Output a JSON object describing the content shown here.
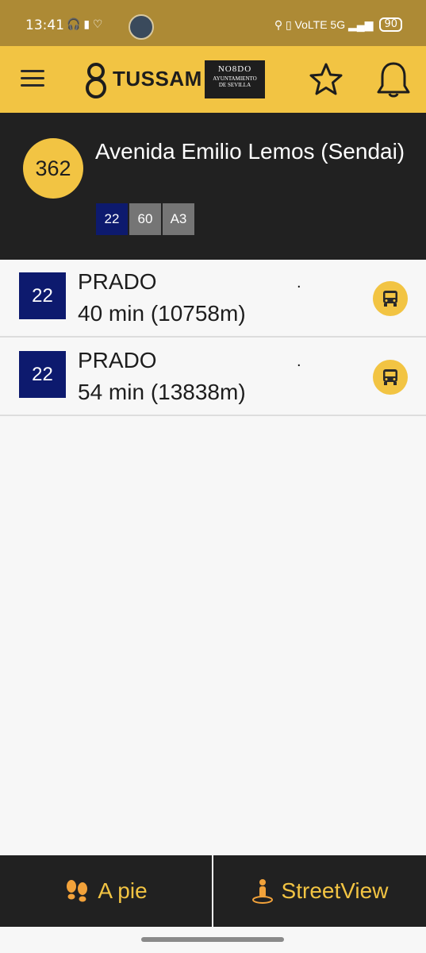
{
  "status_bar": {
    "time": "13:41",
    "left_icons": "🎧 ▮ ♡",
    "right_icons": "⚲ ▯ VoLTE 5G ▂▄▆",
    "battery": "90"
  },
  "app_bar": {
    "brand": "TUSSAM",
    "ayuntamiento_logo": {
      "line1": "NO8DO",
      "line2": "AYUNTAMIENTO",
      "line3": "DE SEVILLA"
    },
    "icons": [
      "menu-icon",
      "star-icon",
      "bell-icon"
    ]
  },
  "stop": {
    "number": "362",
    "name": "Avenida Emilio Lemos (Sendai)",
    "lines": [
      {
        "label": "22",
        "color": "#0d1a6e"
      },
      {
        "label": "60",
        "color": "#757575"
      },
      {
        "label": "A3",
        "color": "#757575"
      }
    ]
  },
  "arrivals": [
    {
      "line": "22",
      "destination": "PRADO",
      "eta": "40 min (10758m)",
      "marker": "."
    },
    {
      "line": "22",
      "destination": "PRADO",
      "eta": "54 min (13838m)",
      "marker": "."
    }
  ],
  "bottom_actions": {
    "walk_label": "A pie",
    "streetview_label": "StreetView"
  },
  "colors": {
    "accent": "#f2c443",
    "dark": "#212121",
    "line_blue": "#0d1a6e",
    "status_bar": "#ad8a35"
  }
}
